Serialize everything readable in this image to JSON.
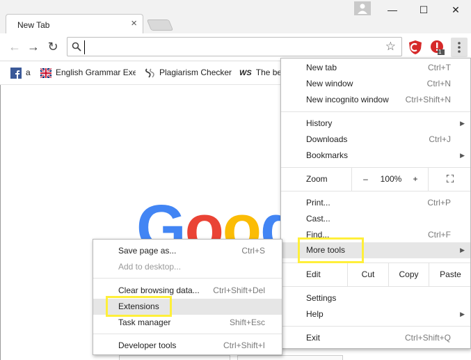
{
  "window": {
    "tab_title": "New Tab",
    "tab_close": "×",
    "minimize": "—",
    "maximize": "☐",
    "close": "✕"
  },
  "toolbar": {
    "back": "←",
    "forward": "→",
    "reload": "↻",
    "omnibox_value": "",
    "star": "☆",
    "ext_badge": "1"
  },
  "bookmarks": [
    {
      "label": "a",
      "icon": "facebook-icon"
    },
    {
      "label": "English Grammar Exe",
      "icon": "uk-flag-icon"
    },
    {
      "label": "Plagiarism Checker",
      "icon": "plagiarism-checker-icon"
    },
    {
      "label": "The be",
      "icon": "ws-icon"
    }
  ],
  "content": {
    "logo_letters": [
      "G",
      "o",
      "o",
      "g"
    ]
  },
  "main_menu": {
    "new_tab": {
      "label": "New tab",
      "shortcut": "Ctrl+T"
    },
    "new_window": {
      "label": "New window",
      "shortcut": "Ctrl+N"
    },
    "new_incognito": {
      "label": "New incognito window",
      "shortcut": "Ctrl+Shift+N"
    },
    "history": {
      "label": "History"
    },
    "downloads": {
      "label": "Downloads",
      "shortcut": "Ctrl+J"
    },
    "bookmarks": {
      "label": "Bookmarks"
    },
    "zoom": {
      "label": "Zoom",
      "minus": "–",
      "level": "100%",
      "plus": "+",
      "fullscreen": "⛶"
    },
    "print": {
      "label": "Print...",
      "shortcut": "Ctrl+P"
    },
    "cast": {
      "label": "Cast..."
    },
    "find": {
      "label": "Find...",
      "shortcut": "Ctrl+F"
    },
    "more_tools": {
      "label": "More tools"
    },
    "edit": {
      "label": "Edit",
      "cut": "Cut",
      "copy": "Copy",
      "paste": "Paste"
    },
    "settings": {
      "label": "Settings"
    },
    "help": {
      "label": "Help"
    },
    "exit": {
      "label": "Exit",
      "shortcut": "Ctrl+Shift+Q"
    }
  },
  "more_tools_menu": {
    "save_page": {
      "label": "Save page as...",
      "shortcut": "Ctrl+S"
    },
    "add_to_desktop": {
      "label": "Add to desktop..."
    },
    "clear_browsing": {
      "label": "Clear browsing data...",
      "shortcut": "Ctrl+Shift+Del"
    },
    "extensions": {
      "label": "Extensions"
    },
    "task_manager": {
      "label": "Task manager",
      "shortcut": "Shift+Esc"
    },
    "developer_tools": {
      "label": "Developer tools",
      "shortcut": "Ctrl+Shift+I"
    }
  },
  "colors": {
    "highlight": "#ffef3a",
    "google_blue": "#4285f4",
    "google_red": "#ea4335",
    "google_yellow": "#fbbc05",
    "adblock_red": "#d62a2a"
  }
}
